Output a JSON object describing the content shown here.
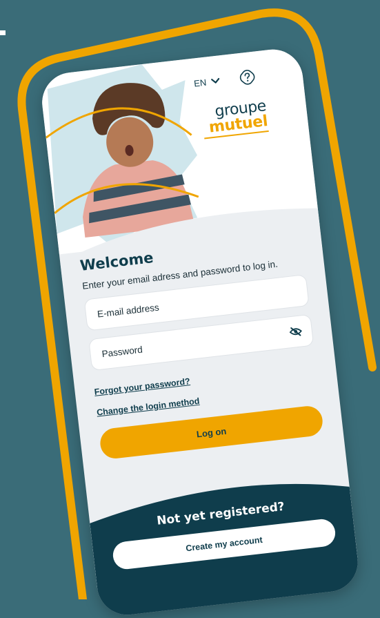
{
  "topbar": {
    "language": "EN",
    "chevron_icon": "chevron-down-icon",
    "help_icon": "help-icon"
  },
  "logo": {
    "line1": "groupe",
    "line2": "mutuel"
  },
  "login": {
    "title": "Welcome",
    "subtitle": "Enter your email adress and password to log in.",
    "email_placeholder": "E-mail address",
    "password_placeholder": "Password",
    "toggle_visibility_icon": "eye-off-icon",
    "forgot_password": "Forgot your password?",
    "change_method": "Change the login method",
    "submit": "Log on"
  },
  "register": {
    "heading": "Not yet registered?",
    "button": "Create my account"
  },
  "colors": {
    "background": "#3a6c78",
    "accent": "#f0a500",
    "brand_dark": "#0f3d4c",
    "form_bg": "#eceff2"
  }
}
